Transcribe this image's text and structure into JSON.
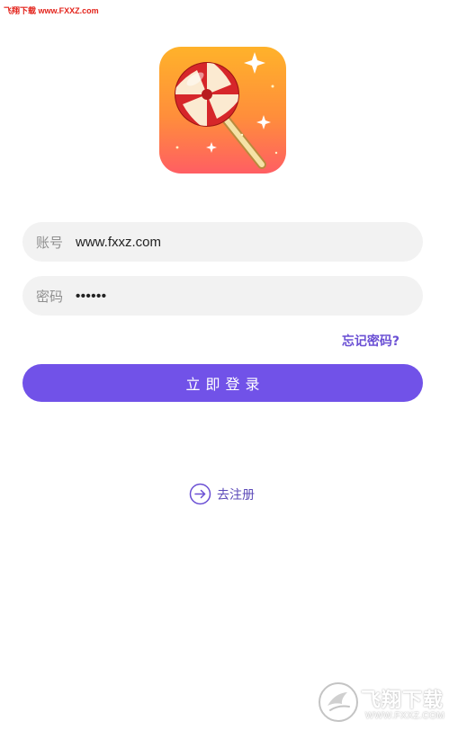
{
  "watermark": {
    "top_left": "飞翔下载 www.FXXZ.com",
    "bottom_right_title": "飞翔下载",
    "bottom_right_url": "WWW.FXXZ.COM"
  },
  "app_icon": {
    "icon": "lollipop-icon"
  },
  "login_form": {
    "account": {
      "label": "账号",
      "value": "www.fxxz.com"
    },
    "password": {
      "label": "密码",
      "value": "••••••"
    },
    "forgot_password": "忘记密码?",
    "submit_label": "立即登录"
  },
  "register": {
    "icon": "arrow-right-circle-icon",
    "label": "去注册"
  },
  "colors": {
    "accent": "#7152e8",
    "link": "#6a4fd4",
    "field_bg": "#f2f2f2",
    "watermark_red": "#e3231b"
  }
}
